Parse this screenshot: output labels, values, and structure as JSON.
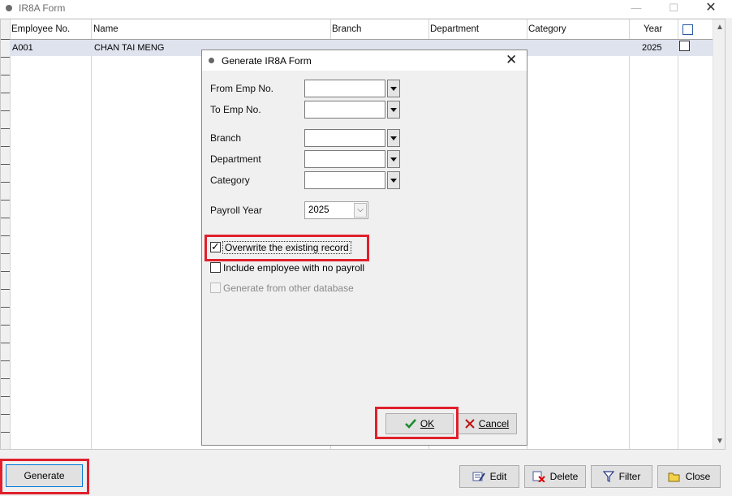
{
  "window": {
    "title": "IR8A Form"
  },
  "grid": {
    "columns": [
      "Employee No.",
      "Name",
      "Branch",
      "Department",
      "Category",
      "Year"
    ],
    "rows": [
      {
        "employee_no": "A001",
        "name": "CHAN TAI MENG",
        "branch": "",
        "department": "",
        "category": "",
        "year": "2025",
        "selected": false
      }
    ]
  },
  "buttons": {
    "generate": "Generate",
    "edit": "Edit",
    "delete": "Delete",
    "filter": "Filter",
    "close": "Close"
  },
  "dialog": {
    "title": "Generate IR8A Form",
    "labels": {
      "from_emp": "From Emp No.",
      "to_emp": "To Emp No.",
      "branch": "Branch",
      "department": "Department",
      "category": "Category",
      "payroll_year": "Payroll Year"
    },
    "payroll_year_value": "2025",
    "checkboxes": {
      "overwrite": {
        "label": "Overwrite the existing record",
        "checked": true
      },
      "include_no_payroll": {
        "label": "Include employee with no payroll",
        "checked": false
      },
      "other_db": {
        "label": "Generate from other database",
        "checked": false,
        "disabled": true
      }
    },
    "ok": "OK",
    "cancel": "Cancel"
  },
  "colors": {
    "highlight": "#e0202c",
    "row_selected": "#dfe3ee"
  }
}
